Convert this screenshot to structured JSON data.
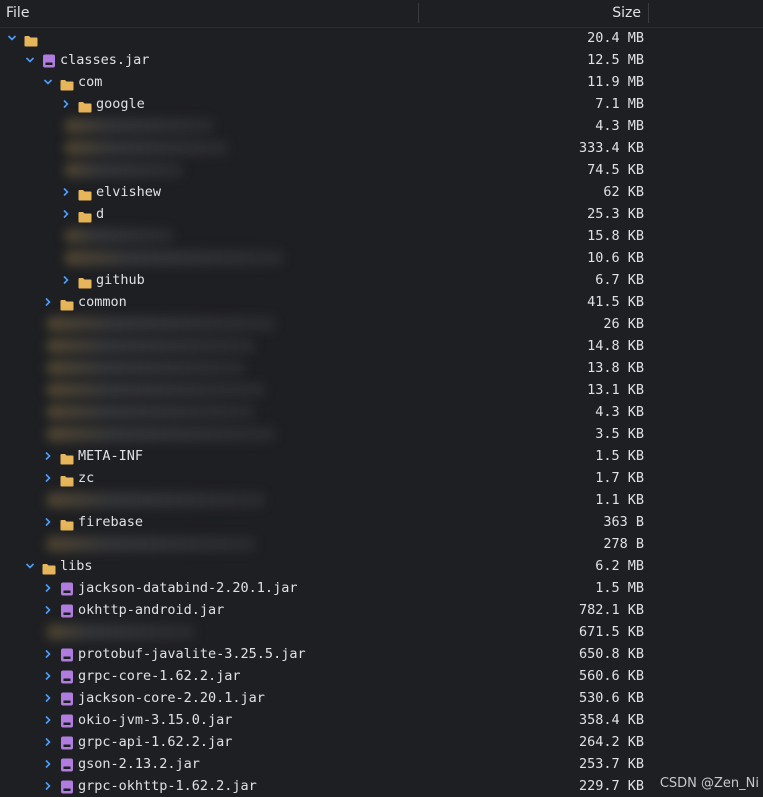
{
  "header": {
    "file_label": "File",
    "size_label": "Size"
  },
  "colors": {
    "folder": "#e8b65a",
    "jar": "#b07ce0",
    "chevron": "#4b9eff",
    "background": "#1e1f22"
  },
  "rows": [
    {
      "level": 0,
      "chevron": "down",
      "icon": "folder-icon",
      "name": "",
      "size": "20.4 MB"
    },
    {
      "level": 1,
      "chevron": "down",
      "icon": "jar-icon",
      "name": "classes.jar",
      "size": "12.5 MB"
    },
    {
      "level": 2,
      "chevron": "down",
      "icon": "folder-icon",
      "name": "com",
      "size": "11.9 MB"
    },
    {
      "level": 3,
      "chevron": "right",
      "icon": "folder-icon",
      "name": "google",
      "size": "7.1 MB"
    },
    {
      "level": 3,
      "chevron": "none",
      "icon": "none",
      "name": "",
      "size": "4.3 MB",
      "redacted": true
    },
    {
      "level": 3,
      "chevron": "none",
      "icon": "none",
      "name": "",
      "size": "333.4 KB",
      "redacted": true
    },
    {
      "level": 3,
      "chevron": "none",
      "icon": "none",
      "name": "",
      "size": "74.5 KB",
      "redacted": true
    },
    {
      "level": 3,
      "chevron": "right",
      "icon": "folder-icon",
      "name": "elvishew",
      "size": "62 KB"
    },
    {
      "level": 3,
      "chevron": "right",
      "icon": "folder-icon",
      "name": "d",
      "size": "25.3 KB"
    },
    {
      "level": 3,
      "chevron": "none",
      "icon": "none",
      "name": "",
      "size": "15.8 KB",
      "redacted": true
    },
    {
      "level": 3,
      "chevron": "none",
      "icon": "none",
      "name": "",
      "size": "10.6 KB",
      "redacted": true
    },
    {
      "level": 3,
      "chevron": "right",
      "icon": "folder-icon",
      "name": "github",
      "size": "6.7 KB"
    },
    {
      "level": 2,
      "chevron": "right",
      "icon": "folder-icon",
      "name": "common",
      "size": "41.5 KB"
    },
    {
      "level": 2,
      "chevron": "none",
      "icon": "none",
      "name": "",
      "size": "26 KB",
      "redacted": true
    },
    {
      "level": 2,
      "chevron": "none",
      "icon": "none",
      "name": "",
      "size": "14.8 KB",
      "redacted": true
    },
    {
      "level": 2,
      "chevron": "none",
      "icon": "none",
      "name": "",
      "size": "13.8 KB",
      "redacted": true
    },
    {
      "level": 2,
      "chevron": "none",
      "icon": "none",
      "name": "",
      "size": "13.1 KB",
      "redacted": true
    },
    {
      "level": 2,
      "chevron": "none",
      "icon": "none",
      "name": "",
      "size": "4.3 KB",
      "redacted": true
    },
    {
      "level": 2,
      "chevron": "none",
      "icon": "none",
      "name": "",
      "size": "3.5 KB",
      "redacted": true
    },
    {
      "level": 2,
      "chevron": "right",
      "icon": "folder-icon",
      "name": "META-INF",
      "size": "1.5 KB"
    },
    {
      "level": 2,
      "chevron": "right",
      "icon": "folder-icon",
      "name": "zc",
      "size": "1.7 KB"
    },
    {
      "level": 2,
      "chevron": "none",
      "icon": "none",
      "name": "",
      "size": "1.1 KB",
      "redacted": true
    },
    {
      "level": 2,
      "chevron": "right",
      "icon": "folder-icon",
      "name": "firebase",
      "size": "363 B"
    },
    {
      "level": 2,
      "chevron": "none",
      "icon": "none",
      "name": "",
      "size": "278 B",
      "redacted": true
    },
    {
      "level": 1,
      "chevron": "down",
      "icon": "folder-icon",
      "name": "libs",
      "size": "6.2 MB"
    },
    {
      "level": 2,
      "chevron": "right",
      "icon": "jar-icon",
      "name": "jackson-databind-2.20.1.jar",
      "size": "1.5 MB"
    },
    {
      "level": 2,
      "chevron": "right",
      "icon": "jar-icon",
      "name": "okhttp-android.jar",
      "size": "782.1 KB"
    },
    {
      "level": 2,
      "chevron": "none",
      "icon": "none",
      "name": "",
      "size": "671.5 KB",
      "redacted": true
    },
    {
      "level": 2,
      "chevron": "right",
      "icon": "jar-icon",
      "name": "protobuf-javalite-3.25.5.jar",
      "size": "650.8 KB"
    },
    {
      "level": 2,
      "chevron": "right",
      "icon": "jar-icon",
      "name": "grpc-core-1.62.2.jar",
      "size": "560.6 KB"
    },
    {
      "level": 2,
      "chevron": "right",
      "icon": "jar-icon",
      "name": "jackson-core-2.20.1.jar",
      "size": "530.6 KB"
    },
    {
      "level": 2,
      "chevron": "right",
      "icon": "jar-icon",
      "name": "okio-jvm-3.15.0.jar",
      "size": "358.4 KB"
    },
    {
      "level": 2,
      "chevron": "right",
      "icon": "jar-icon",
      "name": "grpc-api-1.62.2.jar",
      "size": "264.2 KB"
    },
    {
      "level": 2,
      "chevron": "right",
      "icon": "jar-icon",
      "name": "gson-2.13.2.jar",
      "size": "253.7 KB"
    },
    {
      "level": 2,
      "chevron": "right",
      "icon": "jar-icon",
      "name": "grpc-okhttp-1.62.2.jar",
      "size": "229.7 KB"
    }
  ],
  "watermark": "CSDN @Zen_Ni"
}
